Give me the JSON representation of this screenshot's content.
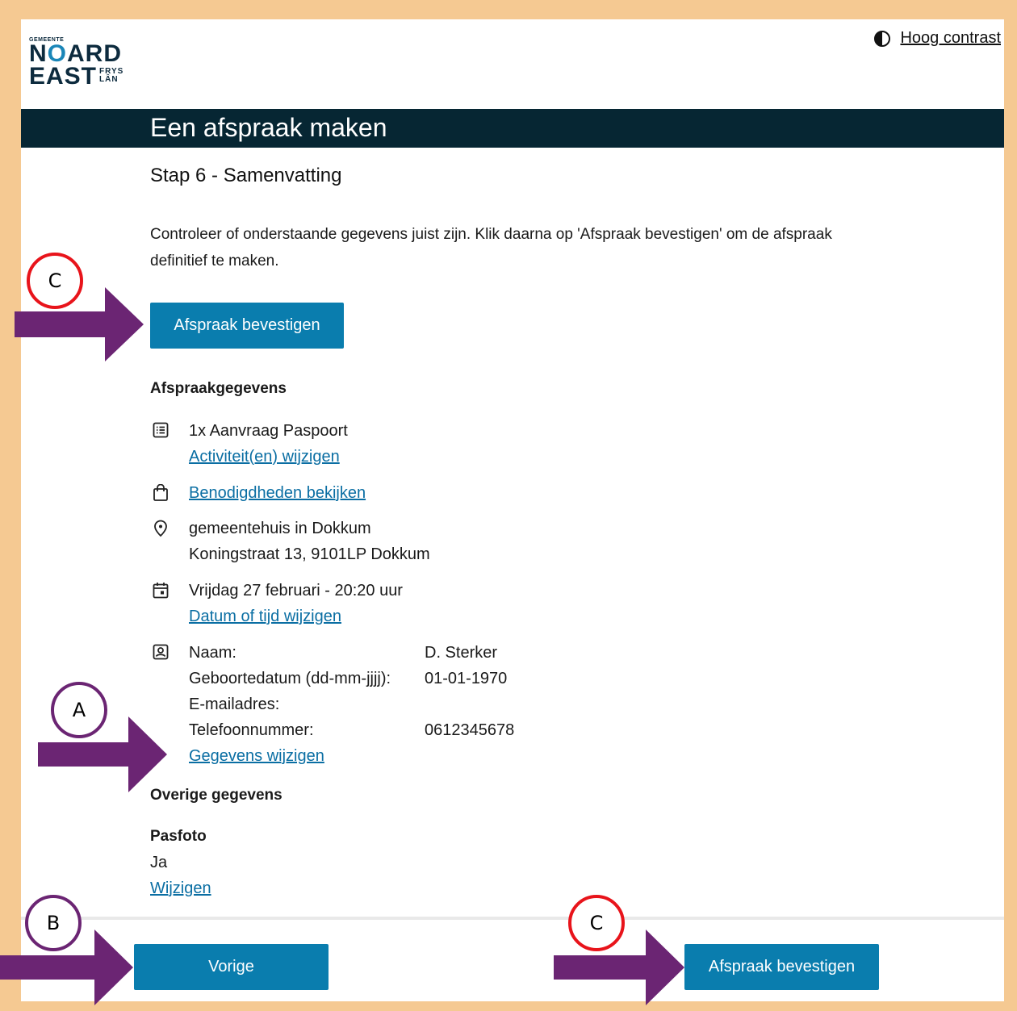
{
  "logo": {
    "small": "GEMEENTE",
    "line1_a": "N",
    "line1_o": "O",
    "line1_b": "ARD",
    "line2": "EAST",
    "fry1": "FRYS",
    "fry2": "LÂN"
  },
  "contrast": {
    "label": "Hoog contrast",
    "icon": "half-circle-icon"
  },
  "page": {
    "title": "Een afspraak maken",
    "step": "Stap 6 - Samenvatting",
    "intro": "Controleer of onderstaande gegevens juist zijn. Klik daarna op 'Afspraak bevestigen' om de afspraak definitief te maken.",
    "confirm_top": "Afspraak bevestigen"
  },
  "appointment": {
    "heading": "Afspraakgegevens",
    "activity": "1x Aanvraag Paspoort",
    "activity_link": "Activiteit(en) wijzigen",
    "needs_link": "Benodigdheden bekijken",
    "location_name": "gemeentehuis in Dokkum",
    "location_address": "Koningstraat 13, 9101LP Dokkum",
    "datetime": "Vrijdag 27 februari - 20:20 uur",
    "datetime_link": "Datum of tijd wijzigen",
    "person": {
      "name_label": "Naam:",
      "name_value": "D. Sterker",
      "dob_label": "Geboortedatum (dd-mm-jjjj):",
      "dob_value": "01-01-1970",
      "email_label": "E-mailadres:",
      "email_value": "",
      "phone_label": "Telefoonnummer:",
      "phone_value": "0612345678"
    },
    "person_link": "Gegevens wijzigen"
  },
  "other": {
    "heading": "Overige gegevens",
    "photo_label": "Pasfoto",
    "photo_value": "Ja",
    "photo_link": "Wijzigen"
  },
  "footer": {
    "prev": "Vorige",
    "confirm": "Afspraak bevestigen"
  },
  "annotations": {
    "c_top": "C",
    "a": "A",
    "b": "B",
    "c_bottom": "C"
  },
  "colors": {
    "primary": "#0a7dae",
    "banner": "#062633",
    "frame": "#f5c992",
    "arrow": "#6b2573",
    "circle_red": "#e8141b"
  }
}
